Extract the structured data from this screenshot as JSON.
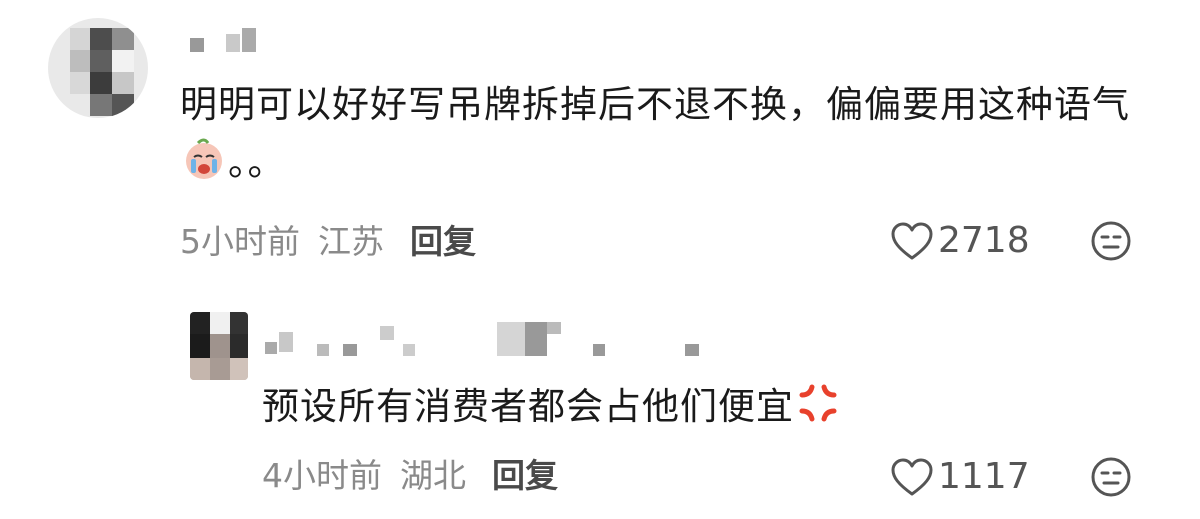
{
  "comments": [
    {
      "text": "明明可以好好写吊牌拆掉后不退不换，偏偏要用这种语气",
      "text_tail": "。。",
      "emoji_icon": "crying-face-icon",
      "time": "5小时前",
      "location": "江苏",
      "reply_label": "回复",
      "likes": "2718"
    },
    {
      "text": "预设所有消费者都会占他们便宜",
      "emoji_icon": "anger-symbol-icon",
      "time": "4小时前",
      "location": "湖北",
      "reply_label": "回复",
      "likes": "1117"
    }
  ],
  "colors": {
    "text": "#1a1a1a",
    "meta": "#8a8a8a",
    "anger": "#e8412c"
  }
}
